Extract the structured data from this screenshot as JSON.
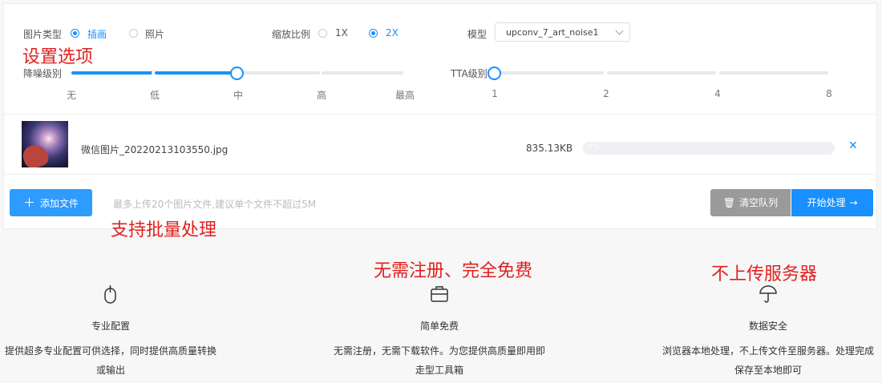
{
  "settings": {
    "image_type_label": "图片类型",
    "image_type_options": [
      "插画",
      "照片"
    ],
    "image_type_selected": "插画",
    "scale_label": "缩放比例",
    "scale_options": [
      "1X",
      "2X"
    ],
    "scale_selected": "2X",
    "model_label": "模型",
    "model_value": "upconv_7_art_noise1",
    "denoise_label": "降噪级别",
    "denoise_ticks": [
      "无",
      "低",
      "中",
      "高",
      "最高"
    ],
    "denoise_value_index": 2,
    "tta_label": "TTA级别",
    "tta_ticks": [
      "1",
      "2",
      "4",
      "8"
    ],
    "tta_value_index": 0
  },
  "annotations": {
    "settings": "设置选项",
    "batch": "支持批量处理",
    "free": "无需注册、完全免费",
    "local": "不上传服务器"
  },
  "file": {
    "name": "微信图片_20220213103550.jpg",
    "size": "835.13KB",
    "progress_text": "0%",
    "progress": 0,
    "remove_icon": "close-icon"
  },
  "actions": {
    "add_label": "添加文件",
    "add_icon": "plus-icon",
    "hint": "最多上传20个图片文件,建议单个文件不超过5M",
    "clear_label": "清空队列",
    "clear_icon": "trash-icon",
    "start_label": "开始处理",
    "start_icon": "arrow-right-icon"
  },
  "features": [
    {
      "icon": "mouse-icon",
      "title": "专业配置",
      "desc1": "提供超多专业配置可供选择，同时提供高质量转换",
      "desc2": "或输出"
    },
    {
      "icon": "briefcase-icon",
      "title": "简单免费",
      "desc1": "无需注册，无需下载软件。为您提供高质量即用即",
      "desc2": "走型工具箱"
    },
    {
      "icon": "umbrella-icon",
      "title": "数据安全",
      "desc1": "浏览器本地处理，不上传文件至服务器。处理完成",
      "desc2": "保存至本地即可"
    }
  ],
  "colors": {
    "accent": "#1890ff",
    "annotation": "#e02020",
    "clear_button": "#9a9a9a"
  }
}
